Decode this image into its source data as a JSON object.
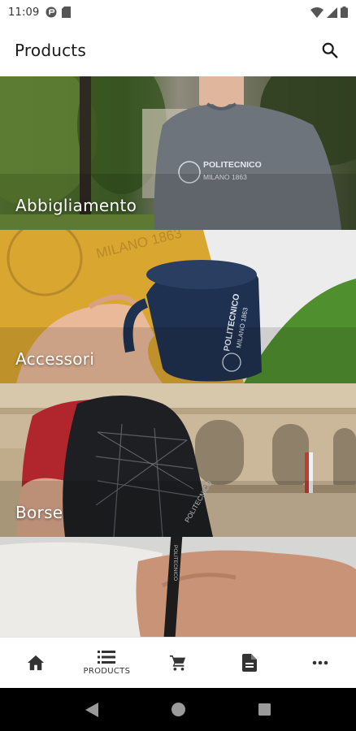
{
  "status_bar": {
    "time": "11:09",
    "icons": [
      "media-icon",
      "sd-card-icon",
      "wifi-icon",
      "signal-icon",
      "battery-icon"
    ]
  },
  "app_bar": {
    "title": "Products",
    "search_icon": "search-icon"
  },
  "categories": [
    {
      "label": "Abbigliamento",
      "scene": "sweatshirt"
    },
    {
      "label": "Accessori",
      "scene": "mug"
    },
    {
      "label": "Borse",
      "scene": "backpack"
    },
    {
      "label": "",
      "scene": "pen"
    }
  ],
  "scene_text": {
    "brand": "POLITECNICO",
    "city": "MILANO 1863"
  },
  "bottom_nav": {
    "items": [
      {
        "icon": "home-icon",
        "label": ""
      },
      {
        "icon": "list-icon",
        "label": "PRODUCTS",
        "active": true
      },
      {
        "icon": "cart-icon",
        "label": ""
      },
      {
        "icon": "document-icon",
        "label": ""
      },
      {
        "icon": "more-icon",
        "label": ""
      }
    ]
  },
  "system_nav": [
    "back-icon",
    "home-circle-icon",
    "recents-icon"
  ],
  "colors": {
    "icon": "#333333",
    "card_label": "#ffffff",
    "system_nav_bg": "#000000"
  }
}
